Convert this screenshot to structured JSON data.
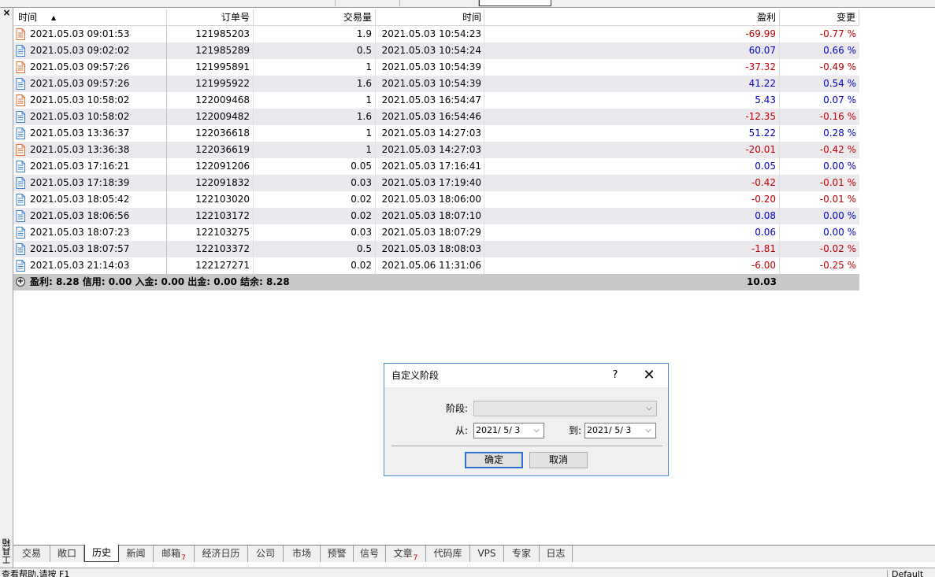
{
  "toolbox": {
    "close_label": "×",
    "title": "工具箱"
  },
  "table": {
    "headers": {
      "time": "时间",
      "order": "订单号",
      "volume": "交易量",
      "close_time": "时间",
      "profit": "盈利",
      "change": "变更"
    },
    "rows": [
      {
        "icon": "sell-order-icon",
        "time": "2021.05.03 09:01:53",
        "order": "121985203",
        "volume": "1.9",
        "close_time": "2021.05.03 10:54:23",
        "profit": "-69.99",
        "change": "-0.77 %",
        "sign": "neg"
      },
      {
        "icon": "buy-order-icon",
        "time": "2021.05.03 09:02:02",
        "order": "121985289",
        "volume": "0.5",
        "close_time": "2021.05.03 10:54:24",
        "profit": "60.07",
        "change": "0.66 %",
        "sign": "pos"
      },
      {
        "icon": "sell-order-icon",
        "time": "2021.05.03 09:57:26",
        "order": "121995891",
        "volume": "1",
        "close_time": "2021.05.03 10:54:39",
        "profit": "-37.32",
        "change": "-0.49 %",
        "sign": "neg"
      },
      {
        "icon": "buy-order-icon",
        "time": "2021.05.03 09:57:26",
        "order": "121995922",
        "volume": "1.6",
        "close_time": "2021.05.03 10:54:39",
        "profit": "41.22",
        "change": "0.54 %",
        "sign": "pos"
      },
      {
        "icon": "sell-order-icon",
        "time": "2021.05.03 10:58:02",
        "order": "122009468",
        "volume": "1",
        "close_time": "2021.05.03 16:54:47",
        "profit": "5.43",
        "change": "0.07 %",
        "sign": "pos"
      },
      {
        "icon": "buy-order-icon",
        "time": "2021.05.03 10:58:02",
        "order": "122009482",
        "volume": "1.6",
        "close_time": "2021.05.03 16:54:46",
        "profit": "-12.35",
        "change": "-0.16 %",
        "sign": "neg"
      },
      {
        "icon": "buy-order-icon",
        "time": "2021.05.03 13:36:37",
        "order": "122036618",
        "volume": "1",
        "close_time": "2021.05.03 14:27:03",
        "profit": "51.22",
        "change": "0.28 %",
        "sign": "pos"
      },
      {
        "icon": "sell-order-icon",
        "time": "2021.05.03 13:36:38",
        "order": "122036619",
        "volume": "1",
        "close_time": "2021.05.03 14:27:03",
        "profit": "-20.01",
        "change": "-0.42 %",
        "sign": "neg"
      },
      {
        "icon": "buy-order-icon",
        "time": "2021.05.03 17:16:21",
        "order": "122091206",
        "volume": "0.05",
        "close_time": "2021.05.03 17:16:41",
        "profit": "0.05",
        "change": "0.00 %",
        "sign": "pos"
      },
      {
        "icon": "buy-order-icon",
        "time": "2021.05.03 17:18:39",
        "order": "122091832",
        "volume": "0.03",
        "close_time": "2021.05.03 17:19:40",
        "profit": "-0.42",
        "change": "-0.01 %",
        "sign": "neg"
      },
      {
        "icon": "buy-order-icon",
        "time": "2021.05.03 18:05:42",
        "order": "122103020",
        "volume": "0.02",
        "close_time": "2021.05.03 18:06:00",
        "profit": "-0.20",
        "change": "-0.01 %",
        "sign": "neg"
      },
      {
        "icon": "buy-order-icon",
        "time": "2021.05.03 18:06:56",
        "order": "122103172",
        "volume": "0.02",
        "close_time": "2021.05.03 18:07:10",
        "profit": "0.08",
        "change": "0.00 %",
        "sign": "pos"
      },
      {
        "icon": "buy-order-icon",
        "time": "2021.05.03 18:07:23",
        "order": "122103275",
        "volume": "0.03",
        "close_time": "2021.05.03 18:07:29",
        "profit": "0.06",
        "change": "0.00 %",
        "sign": "pos"
      },
      {
        "icon": "buy-order-icon",
        "time": "2021.05.03 18:07:57",
        "order": "122103372",
        "volume": "0.5",
        "close_time": "2021.05.03 18:08:03",
        "profit": "-1.81",
        "change": "-0.02 %",
        "sign": "neg"
      },
      {
        "icon": "buy-order-icon",
        "time": "2021.05.03 21:14:03",
        "order": "122127271",
        "volume": "0.02",
        "close_time": "2021.05.06 11:31:06",
        "profit": "-6.00",
        "change": "-0.25 %",
        "sign": "neg"
      }
    ],
    "summary": {
      "text": "盈利: 8.28  信用: 0.00  入金: 0.00  出金: 0.00  结余: 8.28",
      "total": "10.03"
    }
  },
  "dialog": {
    "title": "自定义阶段",
    "help": "?",
    "close": "✕",
    "period_label": "阶段:",
    "period_value": "",
    "from_label": "从:",
    "from_value": "2021/ 5/ 3",
    "to_label": "到:",
    "to_value": "2021/ 5/ 3",
    "ok_label": "确定",
    "cancel_label": "取消"
  },
  "tabs": [
    {
      "label": "交易",
      "badge": ""
    },
    {
      "label": "敞口",
      "badge": ""
    },
    {
      "label": "历史",
      "badge": ""
    },
    {
      "label": "新闻",
      "badge": ""
    },
    {
      "label": "邮箱",
      "badge": "7"
    },
    {
      "label": "经济日历",
      "badge": ""
    },
    {
      "label": "公司",
      "badge": ""
    },
    {
      "label": "市场",
      "badge": ""
    },
    {
      "label": "预警",
      "badge": ""
    },
    {
      "label": "信号",
      "badge": ""
    },
    {
      "label": "文章",
      "badge": "7"
    },
    {
      "label": "代码库",
      "badge": ""
    },
    {
      "label": "VPS",
      "badge": ""
    },
    {
      "label": "专家",
      "badge": ""
    },
    {
      "label": "日志",
      "badge": ""
    }
  ],
  "status": {
    "left": "查看帮助,请按 F1",
    "right": "Default"
  },
  "colors": {
    "negative": "#c00000",
    "positive": "#0000c0",
    "sell_icon": "#e07030",
    "buy_icon": "#3a7fd0"
  }
}
